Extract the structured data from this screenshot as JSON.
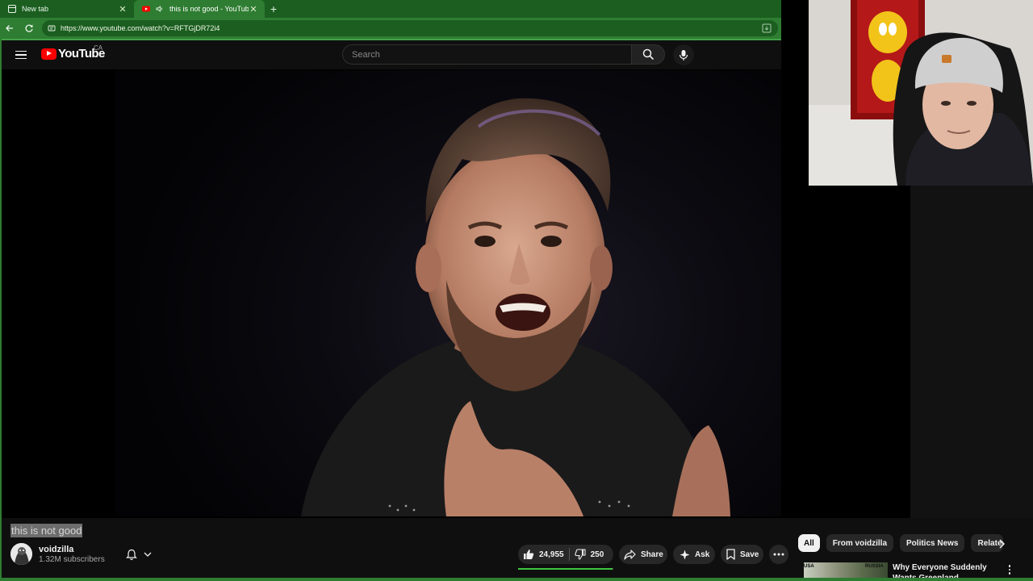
{
  "browser": {
    "tabs": [
      {
        "title": "New tab",
        "active": false,
        "icon": "newtab-page-icon"
      },
      {
        "title": "this is not good - YouTube",
        "active": true,
        "icon": "youtube-favicon",
        "audio": true
      }
    ],
    "url": "https://www.youtube.com/watch?v=RFTGjDR72i4"
  },
  "youtube": {
    "logo_text": "YouTube",
    "country_code": "CA",
    "search_placeholder": "Search"
  },
  "video": {
    "title": "this is not good",
    "channel_name": "voidzilla",
    "subscribers": "1.32M subscribers",
    "likes": "24,955",
    "dislikes": "250",
    "like_ratio": 0.99,
    "share_label": "Share",
    "ask_label": "Ask",
    "save_label": "Save"
  },
  "chips": [
    "All",
    "From voidzilla",
    "Politics News",
    "Related"
  ],
  "recommendation": {
    "title": "Why Everyone Suddenly Wants Greenland",
    "thumb_text_left": "USA",
    "thumb_text_right": "RUSSIA"
  },
  "colors": {
    "browser_frame": "#2e7d32",
    "yt_red": "#ff0000",
    "like_bar_fill": "#3ec73e",
    "page_bg": "#0f0f0f"
  }
}
